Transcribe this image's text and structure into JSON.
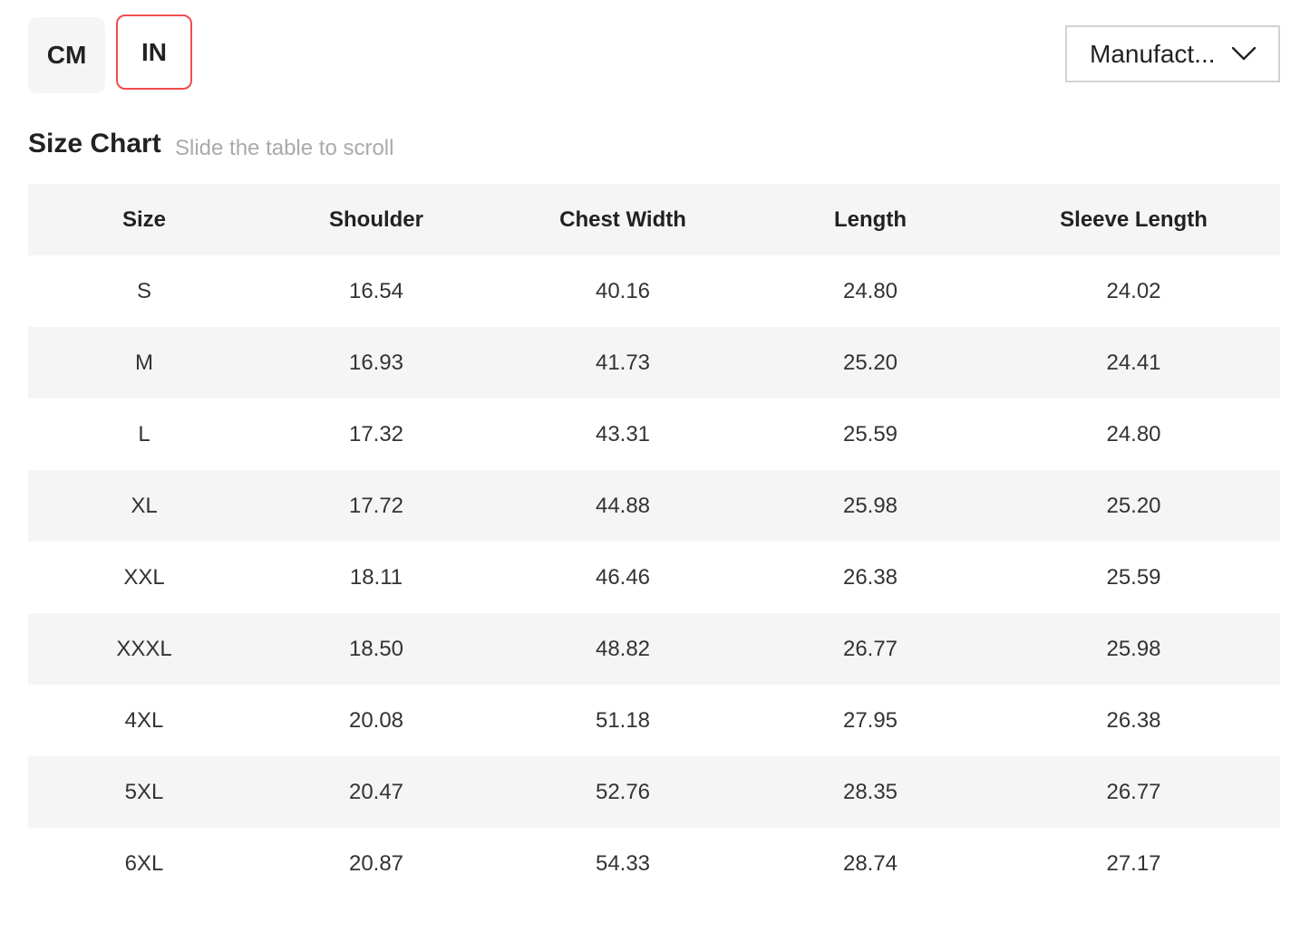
{
  "units": {
    "cm_label": "CM",
    "in_label": "IN",
    "selected": "IN",
    "selected_border_color": "#ee4d4d"
  },
  "dropdown": {
    "value": "Manufact...",
    "icon": "chevron-down-icon"
  },
  "header": {
    "title": "Size Chart",
    "hint": "Slide the table to scroll"
  },
  "table": {
    "columns": [
      "Size",
      "Shoulder",
      "Chest Width",
      "Length",
      "Sleeve Length"
    ],
    "rows": [
      [
        "S",
        "16.54",
        "40.16",
        "24.80",
        "24.02"
      ],
      [
        "M",
        "16.93",
        "41.73",
        "25.20",
        "24.41"
      ],
      [
        "L",
        "17.32",
        "43.31",
        "25.59",
        "24.80"
      ],
      [
        "XL",
        "17.72",
        "44.88",
        "25.98",
        "25.20"
      ],
      [
        "XXL",
        "18.11",
        "46.46",
        "26.38",
        "25.59"
      ],
      [
        "XXXL",
        "18.50",
        "48.82",
        "26.77",
        "25.98"
      ],
      [
        "4XL",
        "20.08",
        "51.18",
        "27.95",
        "26.38"
      ],
      [
        "5XL",
        "20.47",
        "52.76",
        "28.35",
        "26.77"
      ],
      [
        "6XL",
        "20.87",
        "54.33",
        "28.74",
        "27.17"
      ]
    ]
  }
}
